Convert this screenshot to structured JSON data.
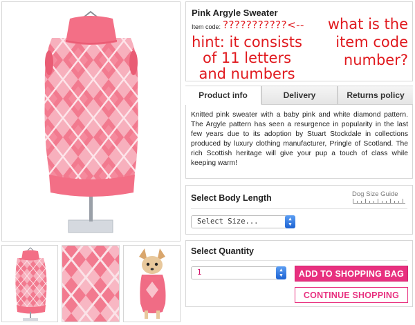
{
  "product": {
    "title": "Pink Argyle Sweater",
    "item_code_label": "Item code:",
    "item_code_value": "???????????<--"
  },
  "annotation": {
    "question_line1": "what is the",
    "question_line2": "item code",
    "question_line3": "number?",
    "hint_line1": "hint: it consists",
    "hint_line2": "of 11 letters",
    "hint_line3": "and numbers",
    "color": "#e0191e"
  },
  "tabs": [
    {
      "label": "Product info",
      "active": true
    },
    {
      "label": "Delivery",
      "active": false
    },
    {
      "label": "Returns policy",
      "active": false
    }
  ],
  "description": "Knitted pink sweater with a baby pink and white diamond pattern. The Argyle pattern has seen a resurgence in popularity in the last few years due to its adoption by Stuart Stockdale in collections produced by luxury clothing manufacturer, Pringle of Scotland. The rich Scottish heritage will give your pup a touch of class while keeping warm!",
  "body_length": {
    "title": "Select Body Length",
    "size_guide_label": "Dog Size Guide",
    "select_value": "Select Size..."
  },
  "quantity": {
    "title": "Select Quantity",
    "value": "1",
    "add_to_bag_label": "ADD TO SHOPPING BAG",
    "continue_label": "CONTINUE SHOPPING"
  },
  "colors": {
    "accent_pink": "#e8307f",
    "sweater_pink": "#f36f86",
    "sweater_light": "#f9c3cc"
  }
}
